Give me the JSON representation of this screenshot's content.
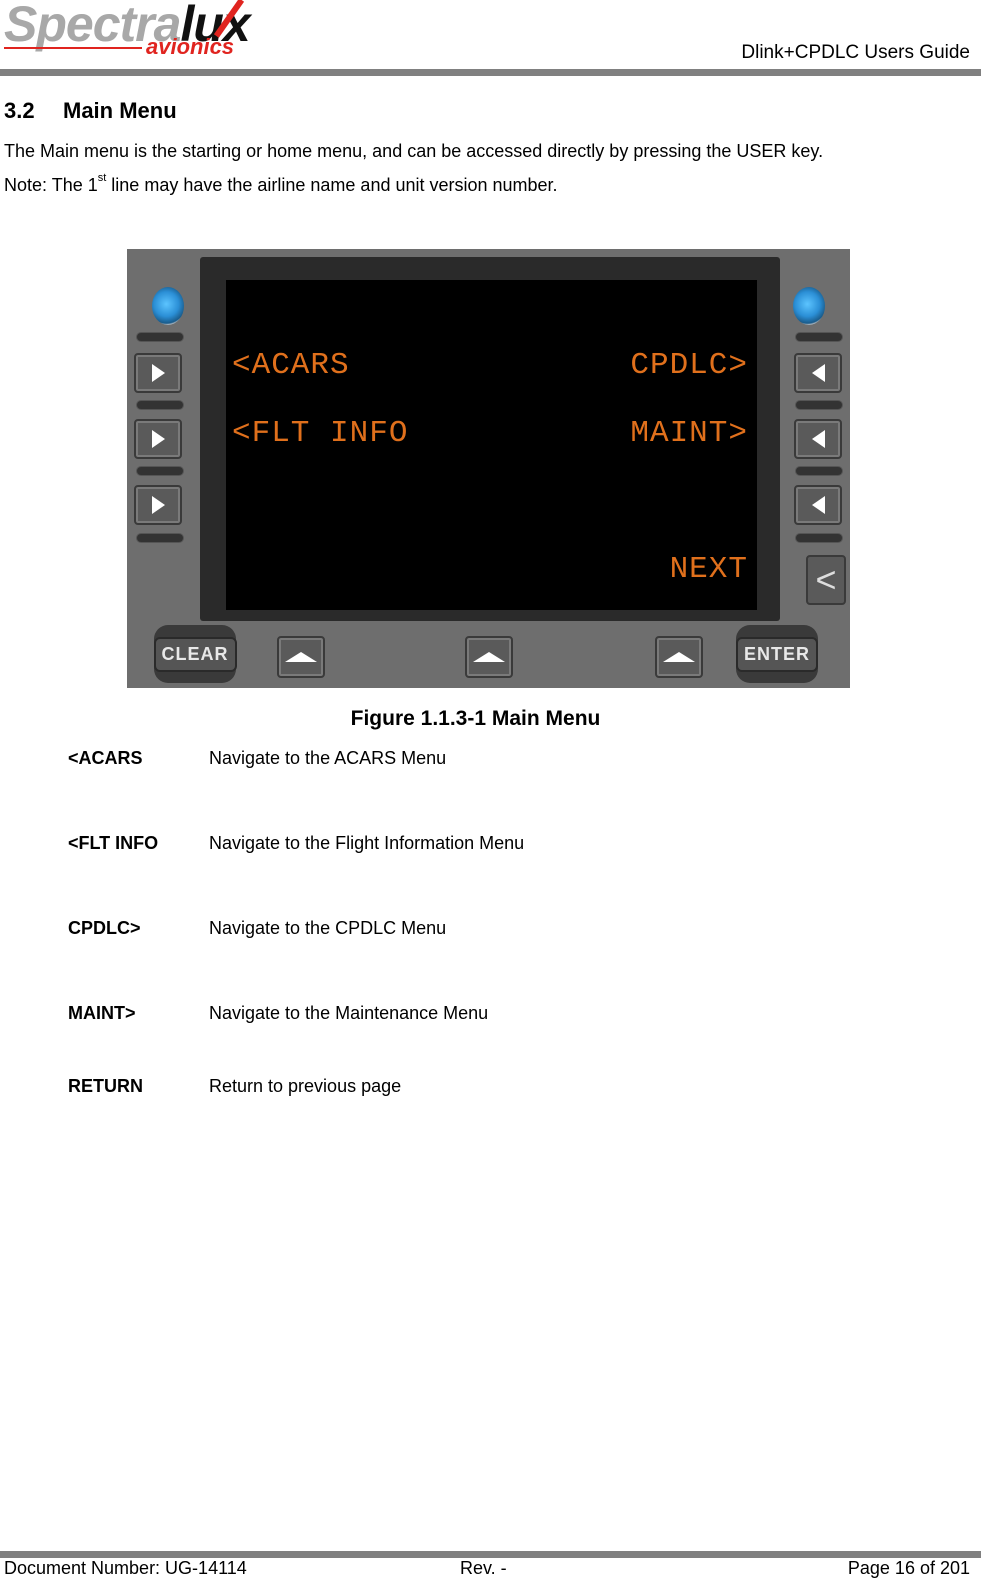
{
  "header": {
    "logo": {
      "brand_light": "Spectra",
      "brand_dark": "lux",
      "sub": "avionics"
    },
    "doc_title": "Dlink+CPDLC Users Guide"
  },
  "section": {
    "number": "3.2",
    "title": "Main Menu",
    "para1": "The Main menu is the starting or home menu, and can be accessed directly by pressing the USER key.",
    "note_prefix": "Note: The 1",
    "note_sup": "st",
    "note_suffix": " line may have the airline name and unit version number."
  },
  "figure": {
    "screen": {
      "left_line1": "<ACARS",
      "right_line1": "CPDLC>",
      "left_line2": "<FLT INFO",
      "right_line2": "MAINT>",
      "right_line6": "NEXT"
    },
    "keys": {
      "clear": "CLEAR",
      "enter": "ENTER",
      "return_glyph": "<"
    },
    "screen_text_color": "#e0701c",
    "caption": "Figure 1.1.3-1 Main Menu"
  },
  "definitions": [
    {
      "term": "<ACARS",
      "desc": "Navigate to the ACARS Menu"
    },
    {
      "term": "<FLT INFO",
      "desc": "Navigate to the Flight Information Menu"
    },
    {
      "term": "CPDLC>",
      "desc": "Navigate to the CPDLC Menu"
    },
    {
      "term": "MAINT>",
      "desc": "Navigate to the Maintenance Menu"
    },
    {
      "term": "RETURN",
      "desc": "Return to previous page"
    }
  ],
  "footer": {
    "doc_number": "Document Number:  UG-14114",
    "rev": "Rev. -",
    "page": "Page 16 of 201"
  }
}
